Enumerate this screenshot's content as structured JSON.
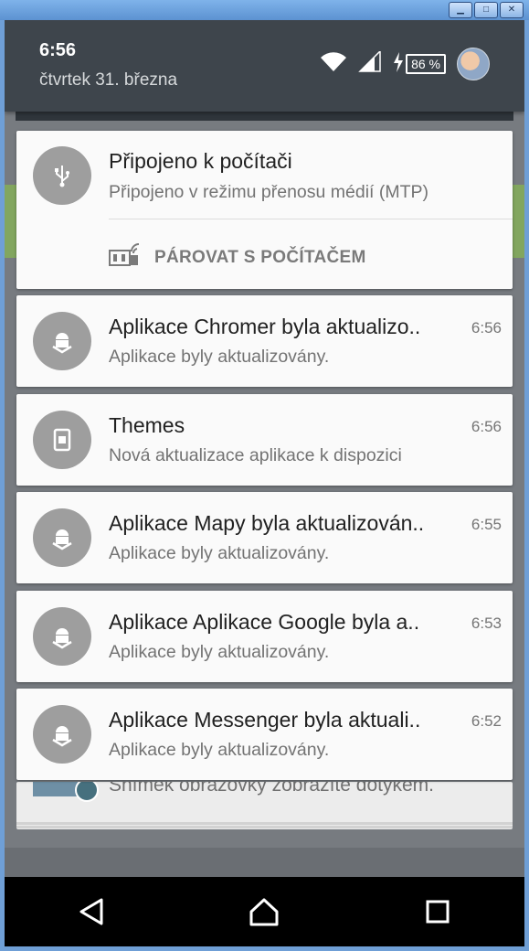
{
  "status": {
    "time": "6:56",
    "date": "čtvrtek 31. března",
    "battery": "86 %"
  },
  "usb_notification": {
    "title": "Připojeno k počítači",
    "text": "Připojeno v režimu přenosu médií (MTP)",
    "action_label": "PÁROVAT S POČÍTAČEM"
  },
  "notifications": [
    {
      "title": "Aplikace Chromer byla aktualizo..",
      "text": "Aplikace byly aktualizovány.",
      "time": "6:56",
      "icon": "android-update-icon"
    },
    {
      "title": "Themes",
      "text": "Nová aktualizace aplikace k dispozici",
      "time": "6:56",
      "icon": "themes-icon"
    },
    {
      "title": "Aplikace Mapy byla aktualizován..",
      "text": "Aplikace byly aktualizovány.",
      "time": "6:55",
      "icon": "android-update-icon"
    },
    {
      "title": "Aplikace Aplikace Google byla a..",
      "text": "Aplikace byly aktualizovány.",
      "time": "6:53",
      "icon": "android-update-icon"
    },
    {
      "title": "Aplikace Messenger byla aktuali..",
      "text": "Aplikace byly aktualizovány.",
      "time": "6:52",
      "icon": "android-update-icon"
    }
  ],
  "peek_notification": {
    "text": "Snímek obrazovky zobrazíte dotykem."
  },
  "colors": {
    "header_bg": "#3e454c",
    "card_bg": "#fafafa",
    "icon_circle": "#9e9e9e",
    "navbar_bg": "#000000"
  }
}
